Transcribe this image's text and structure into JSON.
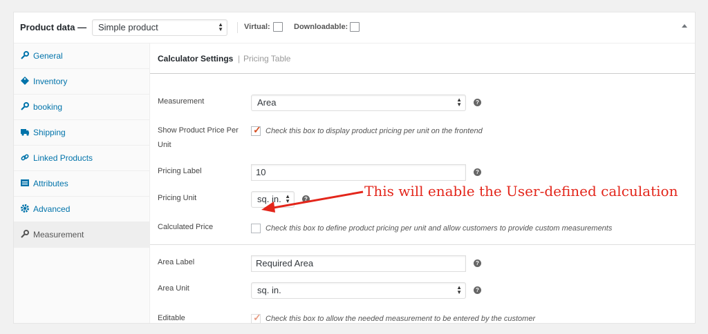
{
  "header": {
    "title": "Product data —",
    "product_type": "Simple product",
    "virtual_label": "Virtual:",
    "downloadable_label": "Downloadable:"
  },
  "sidebar": {
    "items": [
      {
        "label": "General",
        "icon": "wrench-icon"
      },
      {
        "label": "Inventory",
        "icon": "tag-icon"
      },
      {
        "label": "booking",
        "icon": "wrench-icon"
      },
      {
        "label": "Shipping",
        "icon": "truck-icon"
      },
      {
        "label": "Linked Products",
        "icon": "link-icon"
      },
      {
        "label": "Attributes",
        "icon": "list-icon"
      },
      {
        "label": "Advanced",
        "icon": "gear-icon"
      },
      {
        "label": "Measurement",
        "icon": "wrench-icon",
        "active": true
      }
    ]
  },
  "subnav": {
    "current": "Calculator Settings",
    "separator": "|",
    "link": "Pricing Table"
  },
  "fields": {
    "measurement": {
      "label": "Measurement",
      "value": "Area"
    },
    "show_price": {
      "label_line1": "Show Product Price Per",
      "label_line2": "Unit",
      "checked": true,
      "description": "Check this box to display product pricing per unit on the frontend"
    },
    "pricing_label": {
      "label": "Pricing Label",
      "value": "10"
    },
    "pricing_unit": {
      "label": "Pricing Unit",
      "value": "sq. in."
    },
    "calculated_price": {
      "label": "Calculated Price",
      "checked": false,
      "description": "Check this box to define product pricing per unit and allow customers to provide custom measurements"
    },
    "area_label": {
      "label": "Area Label",
      "value": "Required Area"
    },
    "area_unit": {
      "label": "Area Unit",
      "value": "sq. in."
    },
    "editable": {
      "label": "Editable",
      "checked": true,
      "description": "Check this box to allow the needed measurement to be entered by the customer"
    }
  },
  "annotation": {
    "text": "This will enable the User-defined calculation",
    "color": "#e3261b"
  },
  "colors": {
    "link": "#0073aa",
    "checkmark": "#d54e21"
  }
}
